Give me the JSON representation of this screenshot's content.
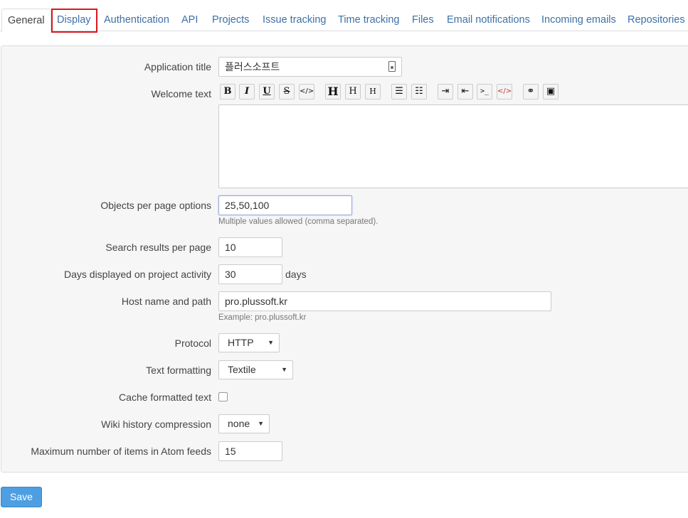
{
  "tabs": [
    {
      "label": "General",
      "active": true
    },
    {
      "label": "Display"
    },
    {
      "label": "Authentication"
    },
    {
      "label": "API"
    },
    {
      "label": "Projects"
    },
    {
      "label": "Issue tracking"
    },
    {
      "label": "Time tracking"
    },
    {
      "label": "Files"
    },
    {
      "label": "Email notifications"
    },
    {
      "label": "Incoming emails"
    },
    {
      "label": "Repositories"
    }
  ],
  "form": {
    "app_title": {
      "label": "Application title",
      "value": "플러스소프트"
    },
    "welcome_text": {
      "label": "Welcome text",
      "value": ""
    },
    "objects_per_page": {
      "label": "Objects per page options",
      "value": "25,50,100",
      "hint": "Multiple values allowed (comma separated)."
    },
    "search_results": {
      "label": "Search results per page",
      "value": "10"
    },
    "days_activity": {
      "label": "Days displayed on project activity",
      "value": "30",
      "suffix": "days"
    },
    "host_name": {
      "label": "Host name and path",
      "value": "pro.plussoft.kr",
      "hint": "Example: pro.plussoft.kr"
    },
    "protocol": {
      "label": "Protocol",
      "value": "HTTP"
    },
    "text_formatting": {
      "label": "Text formatting",
      "value": "Textile"
    },
    "cache_formatted": {
      "label": "Cache formatted text",
      "checked": false
    },
    "wiki_compression": {
      "label": "Wiki history compression",
      "value": "none"
    },
    "atom_items": {
      "label": "Maximum number of items in Atom feeds",
      "value": "15"
    }
  },
  "toolbar": {
    "bold": "B",
    "italic": "I",
    "underline": "U",
    "strike": "S",
    "code": "</>",
    "h1": "H",
    "h2": "H",
    "h3": "H",
    "ul": "☰",
    "ol": "☷",
    "indent": "⇥",
    "outdent": "⇤",
    "pre": ">_",
    "code_block": "</>",
    "link": "⚭",
    "image": "▣"
  },
  "actions": {
    "save": "Save"
  },
  "colors": {
    "link": "#3e6fa6",
    "highlight": "#d8181f",
    "save_button": "#4e9ee2"
  }
}
